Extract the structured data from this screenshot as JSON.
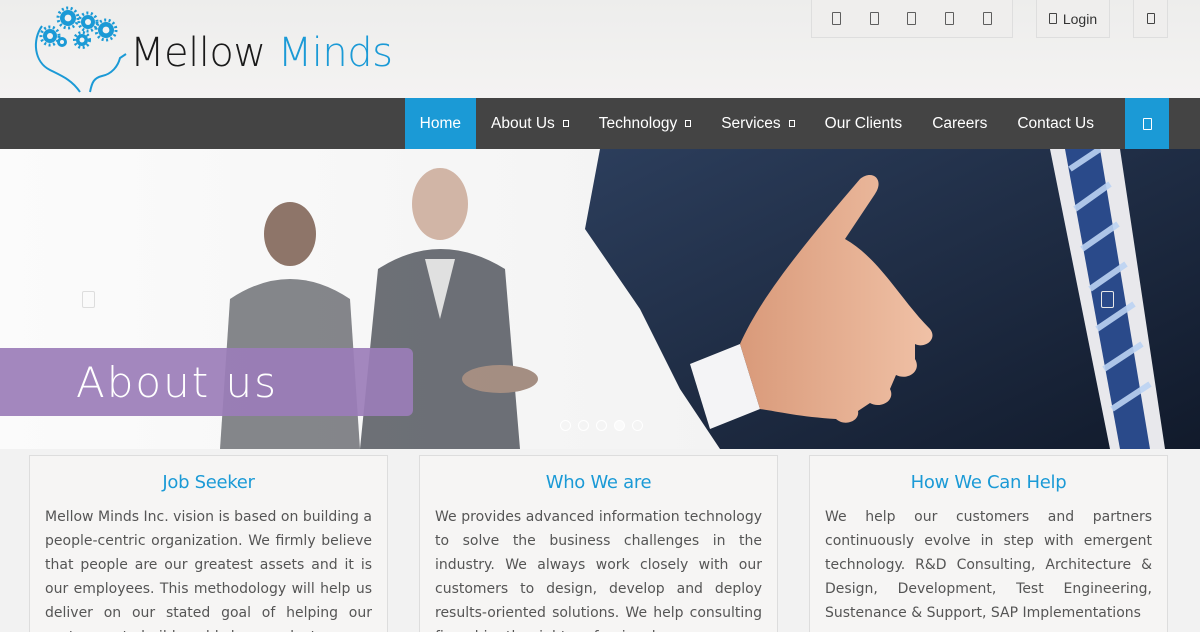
{
  "brand": {
    "word1": "Mellow",
    "word2": "Minds",
    "accent": "#1b9ad6"
  },
  "topbar": {
    "social_icons": [
      "facebook-icon",
      "twitter-icon",
      "linkedin-icon",
      "google-plus-icon",
      "rss-icon"
    ],
    "login_label": "Login"
  },
  "nav": {
    "items": [
      {
        "label": "Home",
        "active": true
      },
      {
        "label": "About Us",
        "dropdown": true
      },
      {
        "label": "Technology",
        "dropdown": true
      },
      {
        "label": "Services",
        "dropdown": true
      },
      {
        "label": "Our Clients"
      },
      {
        "label": "Careers"
      },
      {
        "label": "Contact Us"
      }
    ],
    "bg": "#444444"
  },
  "hero": {
    "banner_text": "About us",
    "banner_color": "#9b7db9"
  },
  "cards": [
    {
      "title": "Job Seeker",
      "body": "Mellow Minds Inc. vision is based on building a people-centric organization. We firmly believe that people are our greatest assets and it is our employees. This methodology will help us deliver on our stated goal of helping our customers to build world class products."
    },
    {
      "title": "Who We are",
      "body": "We provides advanced information technology to solve the business challenges in the industry. We always work closely with our customers to design, develop and deploy results-oriented solutions. We help consulting firms hire the right professionals."
    },
    {
      "title": "How We Can Help",
      "body": "We help our customers and partners continuously evolve in step with emergent technology. R&D Consulting, Architecture & Design, Development, Test Engineering, Sustenance & Support, SAP Implementations"
    }
  ]
}
